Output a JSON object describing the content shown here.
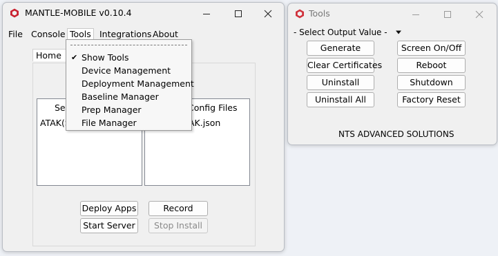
{
  "main_window": {
    "title": "MANTLE-MOBILE v0.10.4",
    "menu": [
      "File",
      "Console",
      "Tools",
      "Integrations",
      "About"
    ],
    "tabs": [
      "Home",
      "I"
    ],
    "left_list": {
      "header": "Sel",
      "items": [
        "ATAK(S"
      ]
    },
    "right_list": {
      "header": "Config Files",
      "items": [
        "AK.json"
      ]
    },
    "buttons": {
      "deploy": "Deploy Apps",
      "record": "Record",
      "start_server": "Start Server",
      "stop_install": "Stop Install"
    }
  },
  "tools_menu": {
    "items": [
      {
        "label": "Show Tools",
        "checked": true
      },
      {
        "label": "Device Management"
      },
      {
        "label": "Deployment Management"
      },
      {
        "label": "Baseline Manager"
      },
      {
        "label": "Prep Manager"
      },
      {
        "label": "File Manager"
      }
    ],
    "check_mark": "✔"
  },
  "tools_window": {
    "title": "Tools",
    "select_label": "- Select Output Value -",
    "buttons_left": [
      "Generate",
      "Clear Certificates",
      "Uninstall",
      "Uninstall All"
    ],
    "buttons_right": [
      "Screen On/Off",
      "Reboot",
      "Shutdown",
      "Factory Reset"
    ],
    "footer": "NTS ADVANCED SOLUTIONS"
  },
  "colors": {
    "logo_red": "#c8202f",
    "accent": "#d0323c"
  }
}
